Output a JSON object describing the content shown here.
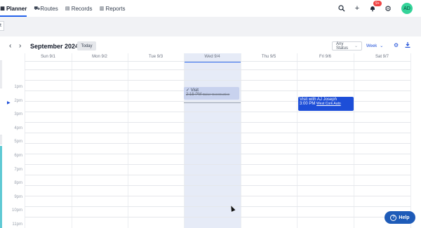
{
  "nav": {
    "items": [
      {
        "label": "Planner",
        "icon": "planner-icon",
        "active": true
      },
      {
        "label": "Routes",
        "icon": "routes-icon",
        "active": false
      },
      {
        "label": "Records",
        "icon": "records-icon",
        "active": false
      },
      {
        "label": "Reports",
        "icon": "reports-icon",
        "active": false
      }
    ],
    "notification_count": "9+",
    "avatar_initials": "AD"
  },
  "band": {
    "tab_label": "t"
  },
  "calendar": {
    "month_title": "September 2024",
    "today_label": "Today",
    "status_filter": "Any Status",
    "view_label": "Week",
    "days": [
      "Sun 9/1",
      "Mon 9/2",
      "Tue 9/3",
      "Wed 9/4",
      "Thu 9/5",
      "Fri 9/6",
      "Sat 9/7"
    ],
    "today_index": 3,
    "hours": [
      "1pm",
      "2pm",
      "3pm",
      "4pm",
      "5pm",
      "6pm",
      "7pm",
      "8pm",
      "9pm",
      "10pm",
      "11pm"
    ],
    "events": {
      "visit_done": {
        "title": "Visit",
        "time": "2:15 PM",
        "place": "Baker Construction"
      },
      "visit_aj": {
        "title": "Visit with AJ Joseph",
        "time": "3:00 PM",
        "place": "West Cork Auto"
      }
    }
  },
  "help_label": "Help",
  "colors": {
    "accent": "#2563eb",
    "event_blue": "#1d4ed8",
    "today_bg": "#e6ebf7",
    "done_event": "#c8d2ee",
    "help_button": "#1e5bb8",
    "avatar": "#34d399",
    "badge": "#ef4444",
    "left_strip": "#5fc9d4"
  }
}
